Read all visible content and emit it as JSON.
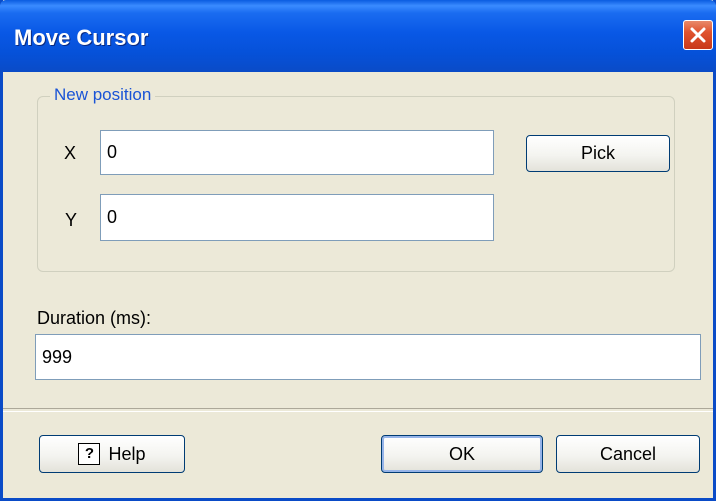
{
  "window": {
    "title": "Move Cursor"
  },
  "new_position": {
    "legend": "New position",
    "x_label": "X",
    "x_value": "0",
    "y_label": "Y",
    "y_value": "0",
    "pick_label": "Pick"
  },
  "duration": {
    "label": "Duration (ms):",
    "value": "999"
  },
  "footer": {
    "help_label": "Help",
    "ok_label": "OK",
    "cancel_label": "Cancel"
  },
  "icons": {
    "close": "close-icon",
    "help": "help-icon"
  },
  "colors": {
    "titlebar": "#0a5ce0",
    "dialog_bg": "#ece9d8",
    "group_legend": "#1a54d6",
    "close_button": "#e0532e"
  }
}
